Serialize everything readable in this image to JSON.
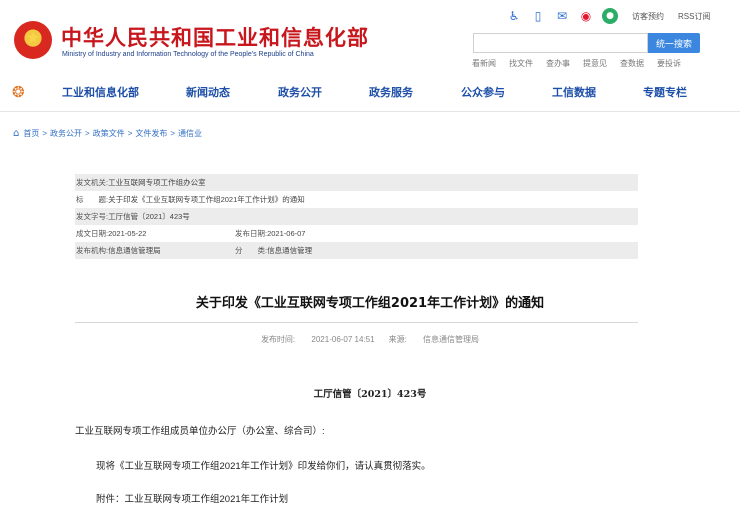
{
  "header": {
    "ministry_name_cn": "中华人民共和国工业和信息化部",
    "ministry_name_en": "Ministry of Industry and Information Technology of the People's Republic of China",
    "top_links": [
      "访客预约",
      "RSS订阅"
    ],
    "icons": [
      "accessibility-icon",
      "mobile-icon",
      "mail-icon",
      "weibo-icon",
      "wechat-icon"
    ],
    "search": {
      "placeholder": "",
      "button_label": "统一搜索"
    },
    "quick_links": [
      "看新闻",
      "找文件",
      "查办事",
      "提意见",
      "查数据",
      "要投诉"
    ]
  },
  "nav": {
    "items": [
      "工业和信息化部",
      "新闻动态",
      "政务公开",
      "政务服务",
      "公众参与",
      "工信数据",
      "专题专栏"
    ]
  },
  "breadcrumb": [
    "首页",
    "政务公开",
    "政策文件",
    "文件发布",
    "通信业"
  ],
  "meta": {
    "issuer_label": "发文机关:",
    "issuer_value": "工业互联网专项工作组办公室",
    "title_label": "标　　题:",
    "title_value": "关于印发《工业互联网专项工作组2021年工作计划》的通知",
    "doc_no_label": "发文字号:",
    "doc_no_value": "工厅信管〔2021〕423号",
    "created_label": "成文日期:",
    "created_value": "2021-05-22",
    "published_label": "发布日期:",
    "published_value": "2021-06-07",
    "org_label": "发布机构:",
    "org_value": "信息通信管理局",
    "category_label": "分　　类:",
    "category_value": "信息通信管理"
  },
  "article": {
    "title": "关于印发《工业互联网专项工作组2021年工作计划》的通知",
    "publish_time_label": "发布时间:",
    "publish_time": "2021-06-07 14:51",
    "source_label": "来源:",
    "source": "信息通信管理局",
    "doc_number": "工厅信管〔2021〕423号",
    "recipient": "工业互联网专项工作组成员单位办公厅（办公室、综合司）:",
    "body": "现将《工业互联网专项工作组2021年工作计划》印发给你们，请认真贯彻落实。",
    "attachment": "附件：工业互联网专项工作组2021年工作计划"
  },
  "colors": {
    "brand_red": "#c8161d",
    "nav_blue": "#1d4fa8",
    "search_button": "#3b87e0",
    "meta_shade": "#ececec"
  }
}
